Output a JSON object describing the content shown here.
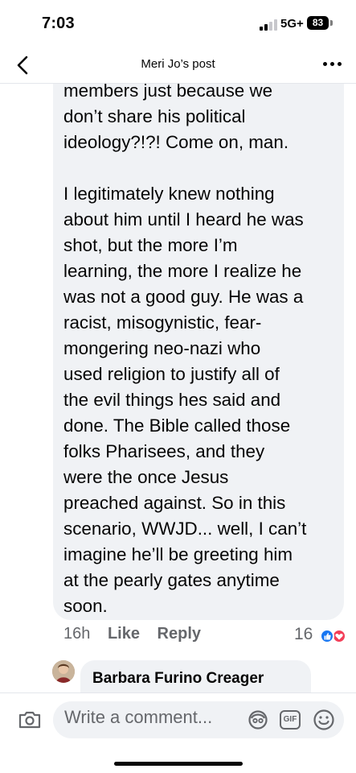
{
  "status_bar": {
    "time": "7:03",
    "network": "5G+",
    "battery": "83"
  },
  "nav": {
    "title": "Meri Jo’s post",
    "back_icon": "chevron-left-icon",
    "more_icon": "more-horizontal-icon"
  },
  "comment": {
    "paragraph1": [
      "members just because we",
      "don’t share his political",
      "ideology?!?! Come on, man."
    ],
    "paragraph2": [
      "I legitimately knew nothing",
      "about him until I heard he was",
      "shot, but the more I’m",
      "learning, the more I realize he",
      "was not a good guy. He was a",
      "racist, misogynistic, fear-",
      "mongering neo-nazi who",
      "used religion to justify all of",
      "the evil things hes said and",
      "done. The Bible called those",
      "folks Pharisees, and they",
      "were the once Jesus",
      "preached against. So in this",
      "scenario, WWJD... well, I can’t",
      "imagine he’ll be greeting him",
      "at the pearly gates anytime",
      "soon."
    ],
    "time_ago": "16h",
    "like_label": "Like",
    "reply_label": "Reply",
    "reaction_count": "16",
    "reactions": [
      "like-reaction-icon",
      "love-reaction-icon"
    ]
  },
  "reply": {
    "author": "Barbara Furino Creager"
  },
  "composer": {
    "placeholder": "Write a comment...",
    "gif_label": "GIF",
    "icons": [
      "camera-icon",
      "avatar-sticker-icon",
      "gif-icon",
      "emoji-icon"
    ]
  },
  "colors": {
    "bubble": "#f0f2f5",
    "secondary_text": "#65676b",
    "like_blue": "#1877f2",
    "love_red": "#f33e58"
  }
}
